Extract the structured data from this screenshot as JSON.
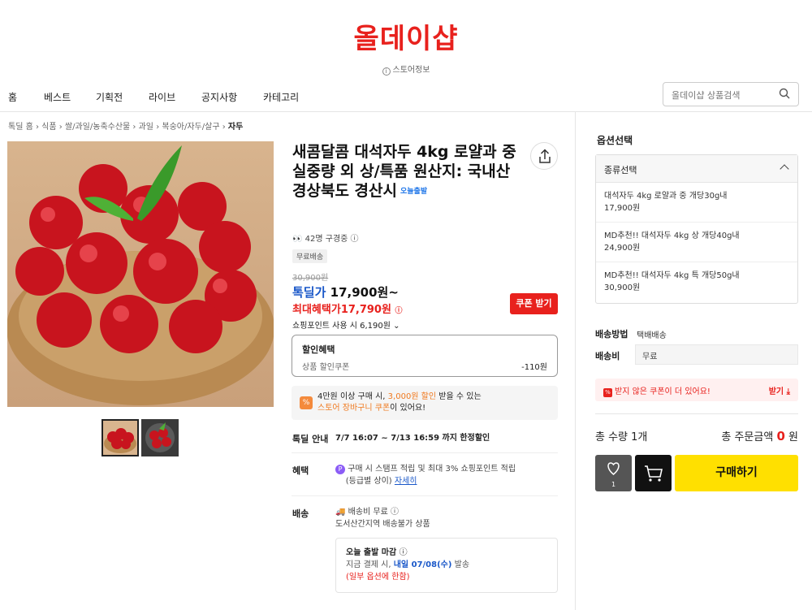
{
  "header": {
    "logo": "올데이샵",
    "store_info": "스토어정보",
    "search_placeholder": "올데이샵 상품검색"
  },
  "nav": {
    "items": [
      "홈",
      "베스트",
      "기획전",
      "라이브",
      "공지사항",
      "카테고리"
    ]
  },
  "breadcrumb": {
    "items": [
      "톡딜 홈",
      "식품",
      "쌀/과일/농축수산물",
      "과일",
      "복숭아/자두/살구"
    ],
    "current": "자두"
  },
  "product": {
    "title": "새콤달콤 대석자두 4kg 로얄과 중 실중량 외 상/특품 원산지: 국내산 경상북도 경산시",
    "badge": "오늘출발",
    "viewing": "42명 구경중",
    "tag": "무료배송",
    "original_price": "30,900원",
    "deal_label": "톡딜가",
    "deal_price": "17,900원~",
    "max_benefit_label": "최대혜택가",
    "max_benefit_price": "17,790원",
    "coupon_button": "쿠폰 받기",
    "points_text": "쇼핑포인트 사용 시 6,190원",
    "discount": {
      "header": "할인혜택",
      "label": "상품 할인쿠폰",
      "value": "-110원"
    },
    "promo": {
      "icon": "%",
      "line1_pre": "4만원 이상 구매 시,",
      "line1_highlight": "3,000원 할인",
      "line1_post": "받을 수 있는",
      "line2_highlight": "스토어 장바구니 쿠폰",
      "line2_post": "이 있어요!"
    },
    "deal_info": {
      "label": "톡딜 안내",
      "text": "7/7 16:07 ~ 7/13 16:59 까지 한정할인"
    },
    "benefit": {
      "label": "혜택",
      "line1": "구매 시 스탬프 적립 및 최대 3% 쇼핑포인트 적립",
      "line2": "(등급별 상이)",
      "link": "자세히"
    },
    "shipping": {
      "label": "배송",
      "line1": "배송비 무료",
      "line2": "도서산간지역 배송불가 상품",
      "box_title": "오늘 출발 마감",
      "box_line_pre": "지금 결제 시,",
      "box_line_bold": "내일 07/08(수)",
      "box_line_post": "발송",
      "box_note": "(일부 옵션에 한함)"
    }
  },
  "options": {
    "title": "옵션선택",
    "dropdown_label": "종류선택",
    "items": [
      {
        "name": "대석자두 4kg 로얄과 중 개당30g내",
        "price": "17,900원"
      },
      {
        "name": "MD추천!! 대석자두 4kg 상 개당40g내",
        "price": "24,900원"
      },
      {
        "name": "MD추천!! 대석자두 4kg 특 개당50g내",
        "price": "30,900원"
      }
    ]
  },
  "delivery": {
    "method_label": "배송방법",
    "method_value": "택배배송",
    "fee_label": "배송비",
    "fee_value": "무료"
  },
  "coupon_notice": {
    "text": "받지 않은 쿠폰이 더 있어요!",
    "action": "받기"
  },
  "summary": {
    "qty_label": "총 수량",
    "qty_value": "1개",
    "total_label": "총 주문금액",
    "total_value": "0",
    "total_unit": "원"
  },
  "actions": {
    "like_count": "1",
    "buy": "구매하기"
  },
  "colors": {
    "brand": "#e8211d",
    "buy_button": "#ffe000",
    "deal_blue": "#1a58c9"
  }
}
